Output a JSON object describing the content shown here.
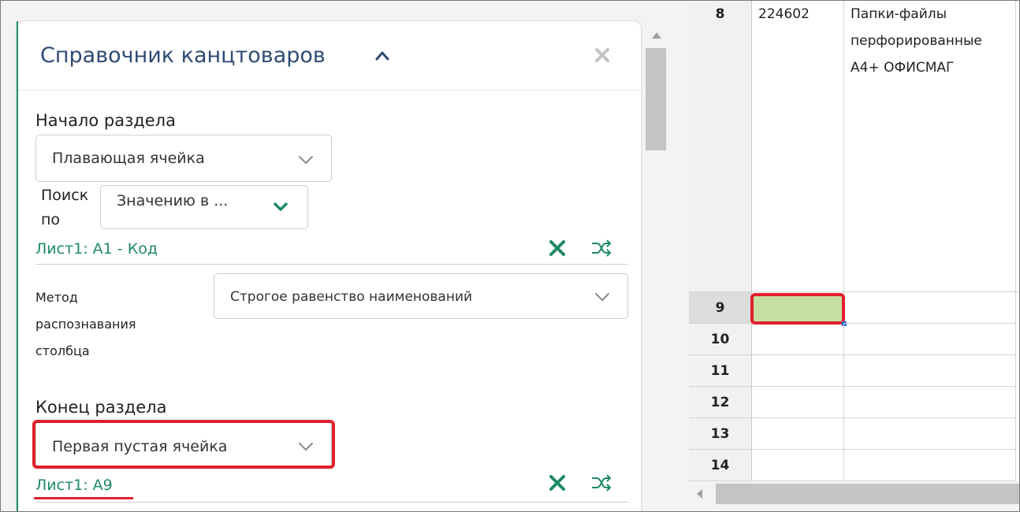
{
  "panel": {
    "title": "Справочник канцтоваров",
    "section_start_label": "Начало раздела",
    "start_type_value": "Плавающая ячейка",
    "search_label": "Поиск по",
    "search_label_line1": "Поиск",
    "search_label_line2": "по",
    "search_value": "Значению в ...",
    "start_ref": "Лист1: A1 - Код",
    "method_label_line1": "Метод",
    "method_label_line2": "распознавания",
    "method_label_line3": "столбца",
    "method_value": "Строгое равенство наименований",
    "section_end_label": "Конец раздела",
    "end_type_value": "Первая пустая ячейка",
    "end_ref": "Лист1: A9"
  },
  "icons": {
    "collapse": "chevron-up-icon",
    "close": "close-icon",
    "clear": "x-icon",
    "shuffle": "shuffle-icon"
  },
  "colors": {
    "accent": "#1f8a63",
    "title": "#2f4b73",
    "highlight": "#e0202e",
    "selected_cell": "#c6e0a4"
  },
  "sheet": {
    "rows": [
      {
        "num": "8",
        "col_a": "224602",
        "col_b_lines": [
          "Папки-файлы",
          "перфорированные",
          "А4+ ОФИСМАГ"
        ]
      },
      {
        "num": "9",
        "col_a": "",
        "col_b_lines": []
      },
      {
        "num": "10",
        "col_a": "",
        "col_b_lines": []
      },
      {
        "num": "11",
        "col_a": "",
        "col_b_lines": []
      },
      {
        "num": "12",
        "col_a": "",
        "col_b_lines": []
      },
      {
        "num": "13",
        "col_a": "",
        "col_b_lines": []
      },
      {
        "num": "14",
        "col_a": "",
        "col_b_lines": []
      }
    ]
  }
}
